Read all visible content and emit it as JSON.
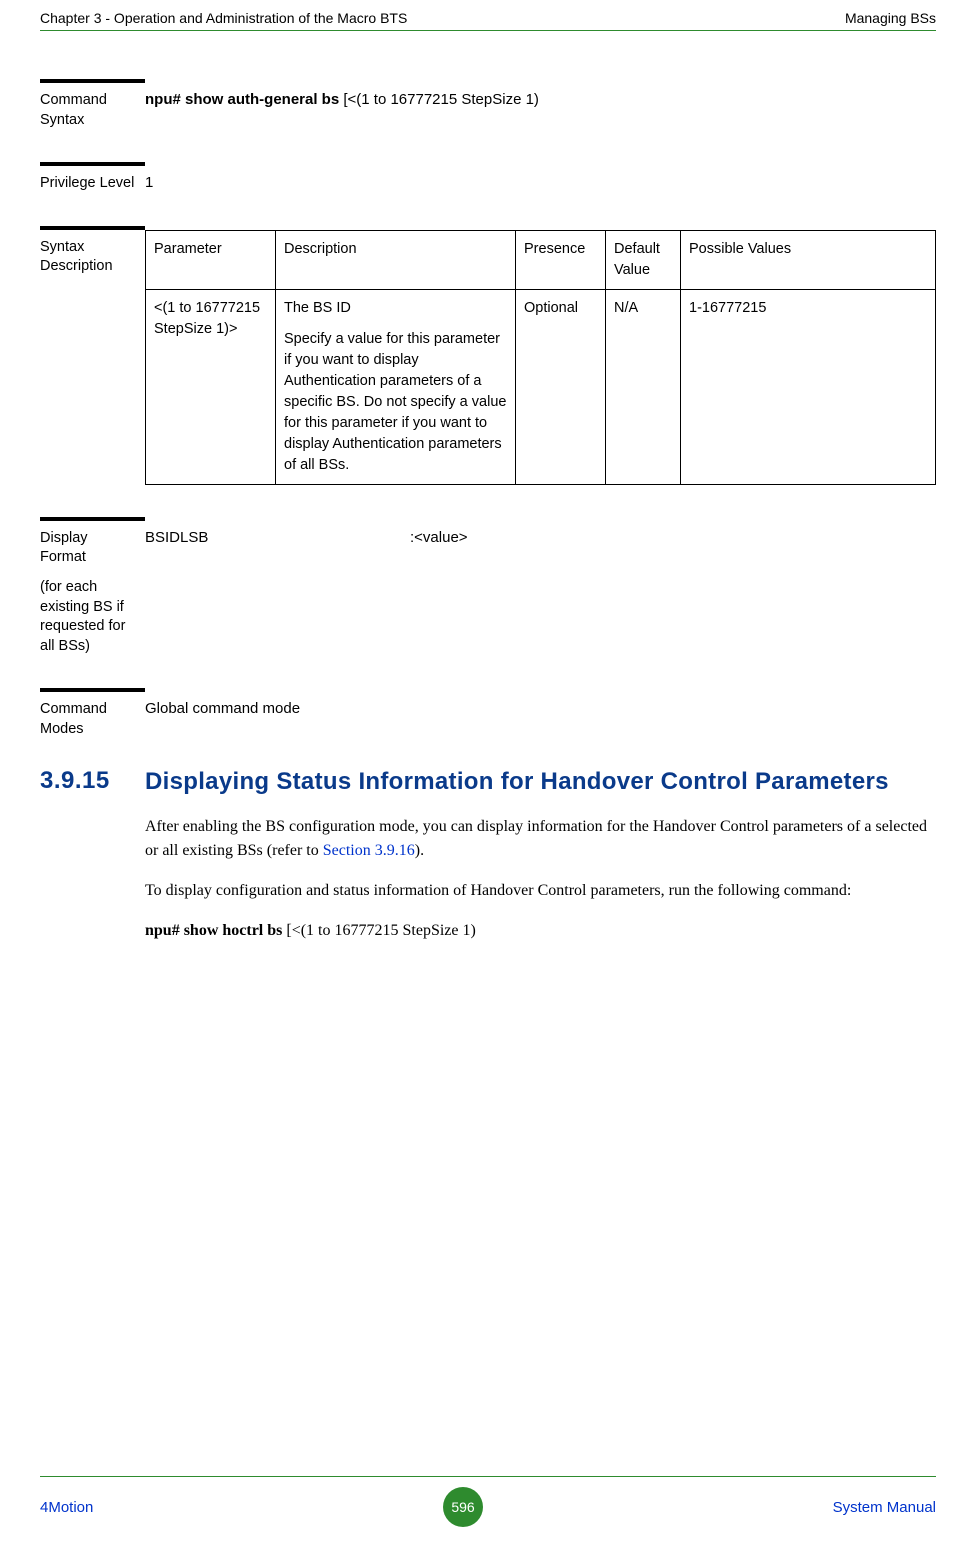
{
  "header": {
    "left": "Chapter 3 - Operation and Administration of the Macro BTS",
    "right": "Managing BSs"
  },
  "blocks": {
    "command_syntax": {
      "label": "Command Syntax",
      "cmd_bold": "npu# show auth-general bs",
      "cmd_rest": " [<(1 to 16777215 StepSize 1)"
    },
    "privilege_level": {
      "label": "Privilege Level",
      "value": "1"
    },
    "syntax_description": {
      "label": "Syntax Description",
      "headers": {
        "c0": "Parameter",
        "c1": "Description",
        "c2": "Presence",
        "c3": "Default Value",
        "c4": "Possible Values"
      },
      "row": {
        "param": "<(1 to 16777215 StepSize 1)>",
        "desc_line1": "The BS ID",
        "desc_line2": "Specify a value for this parameter if you want to display Authentication parameters of a specific BS. Do not specify a value for this parameter if you want to display Authentication parameters of all BSs.",
        "presence": "Optional",
        "default": "N/A",
        "possible": "1-16777215"
      }
    },
    "display_format": {
      "label_line1": "Display Format",
      "label_line2": "(for each existing BS if requested for all BSs)",
      "field": "BSIDLSB",
      "value": ":<value>"
    },
    "command_modes": {
      "label": "Command Modes",
      "value": "Global command mode"
    }
  },
  "section": {
    "number": "3.9.15",
    "title": "Displaying Status Information for Handover Control Parameters",
    "para1_a": "After enabling the BS configuration mode, you can display information for the Handover Control parameters of a selected or all existing BSs (refer to ",
    "para1_link": "Section 3.9.16",
    "para1_b": ").",
    "para2": "To display configuration and status information of Handover Control parameters, run the following command:",
    "cmd_bold": "npu# show hoctrl bs",
    "cmd_rest": " [<(1 to 16777215 StepSize 1)"
  },
  "footer": {
    "left": "4Motion",
    "page": "596",
    "right": "System Manual"
  }
}
